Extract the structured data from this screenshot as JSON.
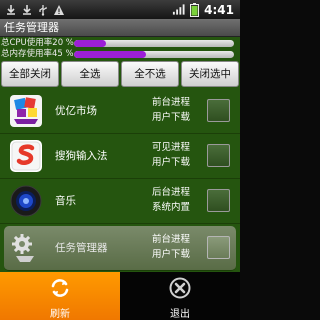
{
  "status_bar": {
    "time": "4:41",
    "left_icons": [
      "download-icon",
      "download-icon",
      "usb-icon",
      "warning-icon"
    ],
    "right_icons": [
      "signal-icon",
      "battery-icon"
    ]
  },
  "title": "任务管理器",
  "usage": {
    "cpu_label": "总CPU使用率20 %",
    "cpu_fraction": 0.2,
    "mem_label": "总内存使用率45 %",
    "mem_fraction": 0.45,
    "bar_color": "#9c1fd6"
  },
  "buttons": {
    "close_all": "全部关闭",
    "select_all": "全选",
    "select_none": "全不选",
    "close_selected": "关闭选中"
  },
  "apps": [
    {
      "name": "优亿市场",
      "state": "前台进程",
      "type": "用户下载",
      "icon": "market-icon"
    },
    {
      "name": "搜狗输入法",
      "state": "可见进程",
      "type": "用户下载",
      "icon": "sogou-icon"
    },
    {
      "name": "音乐",
      "state": "后台进程",
      "type": "系统内置",
      "icon": "music-icon"
    },
    {
      "name": "任务管理器",
      "state": "前台进程",
      "type": "用户下载",
      "icon": "task-manager-icon"
    }
  ],
  "bottom": {
    "refresh": "刷新",
    "exit": "退出"
  }
}
